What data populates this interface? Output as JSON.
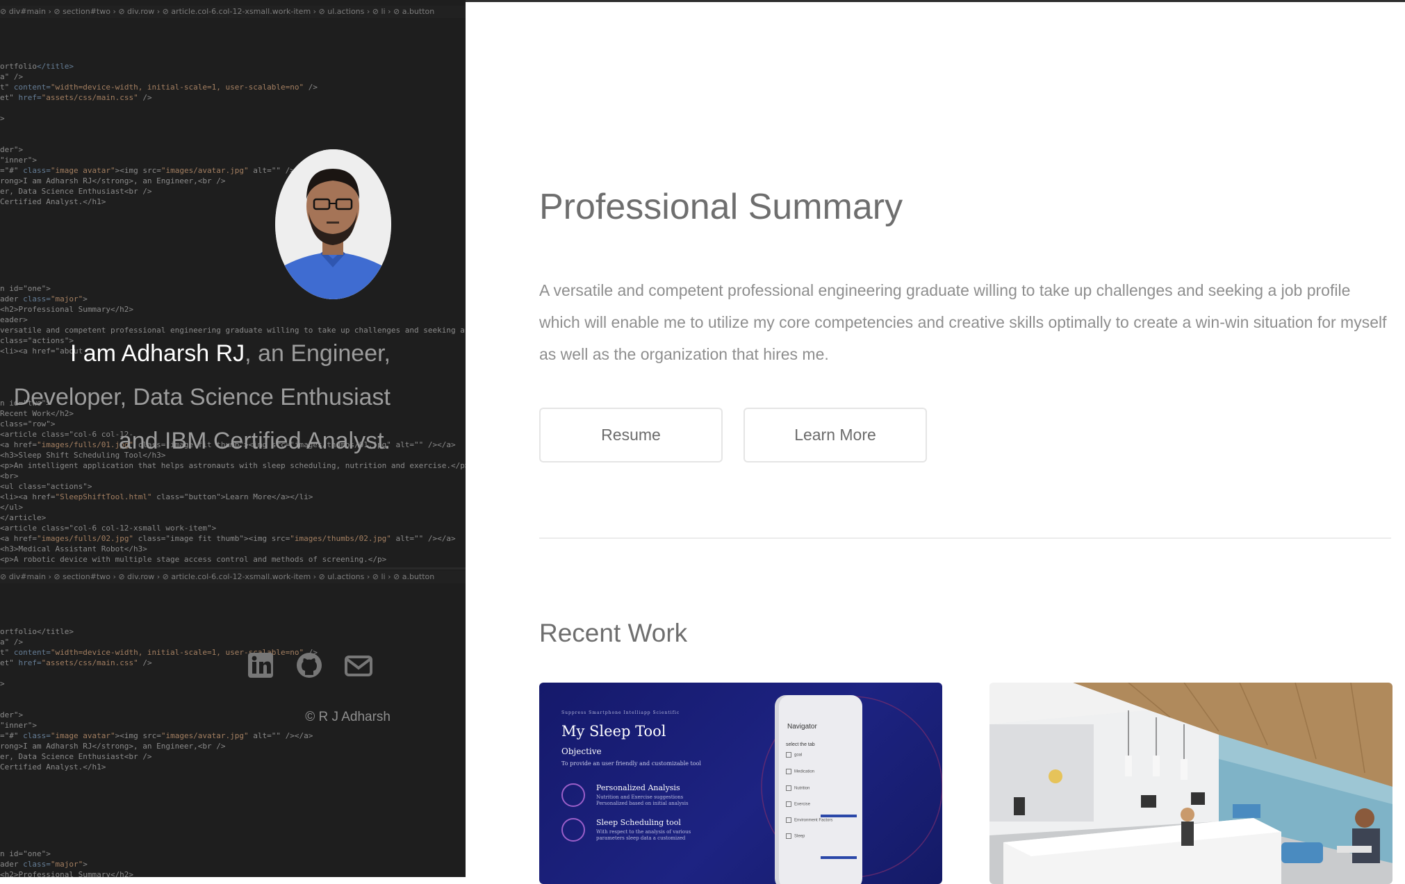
{
  "sidebar": {
    "breadcrumb": "⊘ div#main  ›  ⊘ section#two  ›  ⊘ div.row  ›  ⊘ article.col-6.col-12-xsmall.work-item  ›  ⊘ ul.actions  ›  ⊘ li  ›  ⊘ a.button",
    "intro": {
      "strong": "I am Adharsh RJ",
      "rest_1": ", an Engineer,",
      "line_2": "Developer, Data Science Enthusiast",
      "line_3": "and IBM Certified Analyst."
    },
    "social": [
      "linkedin-icon",
      "github-icon",
      "envelope-icon"
    ],
    "copyright": "© R J Adharsh"
  },
  "main": {
    "summary_title": "Professional Summary",
    "summary_text": "A versatile and competent professional engineering graduate willing to take up challenges and seeking a job profile which will enable me to utilize my core competencies and creative skills optimally to create a win-win situation for myself as well as the organization that hires me.",
    "buttons": {
      "resume": "Resume",
      "learn_more": "Learn More"
    },
    "recent_title": "Recent Work",
    "work": [
      {
        "title": "My Sleep Tool",
        "objective_label": "Objective",
        "objective_text": "To provide an user friendly and customizable tool",
        "nav": "Suppress   Smartphone   Intelliapp   Scientific",
        "features": [
          {
            "title": "Personalized Analysis",
            "desc1": "Nutrition and Exercise suggestions",
            "desc2": "Personalized based on initial analysis"
          },
          {
            "title": "Sleep Scheduling tool",
            "desc1": "With respect to the analysis of various",
            "desc2": "parameters sleep data a customized"
          }
        ],
        "phone": {
          "title": "Navigator",
          "subtitle": "select the tab",
          "options": [
            "goal",
            "Medication",
            "Nutrition",
            "Exercise",
            "Environment Factors",
            "Sleep"
          ]
        }
      },
      {
        "image": "medical-assistant-robot-scene"
      }
    ]
  },
  "colors": {
    "sidebar_bg": "#1e1e1e",
    "heading": "#6e6e6e",
    "body_text": "#8e8e8e",
    "thumb_blue": "#1d2382"
  }
}
